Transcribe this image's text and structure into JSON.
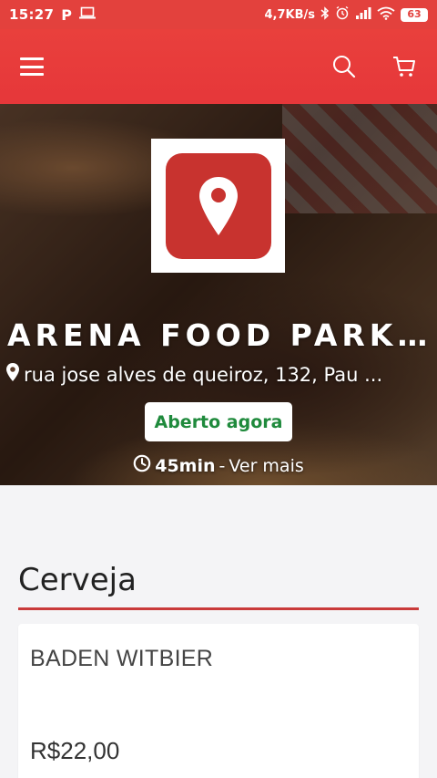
{
  "status_bar": {
    "time": "15:27",
    "network_speed": "4,7KB/s",
    "battery": "63"
  },
  "app_bar": {
    "menu_icon": "hamburger-menu-icon",
    "search_icon": "search-icon",
    "cart_icon": "shopping-cart-icon",
    "background_color": "#e6393b"
  },
  "store": {
    "name": "ARENA FOOD PARK ...",
    "address": "rua jose alves de queiroz, 132, Pau ...",
    "status": "Aberto agora",
    "delivery_time": "45min",
    "more_link": "Ver mais",
    "status_color": "#1f8a3c",
    "logo_color": "#c8332f"
  },
  "menu": {
    "categories": [
      {
        "title": "Cerveja",
        "products": [
          {
            "name": "BADEN WITBIER",
            "price": "R$22,00"
          }
        ]
      }
    ]
  }
}
